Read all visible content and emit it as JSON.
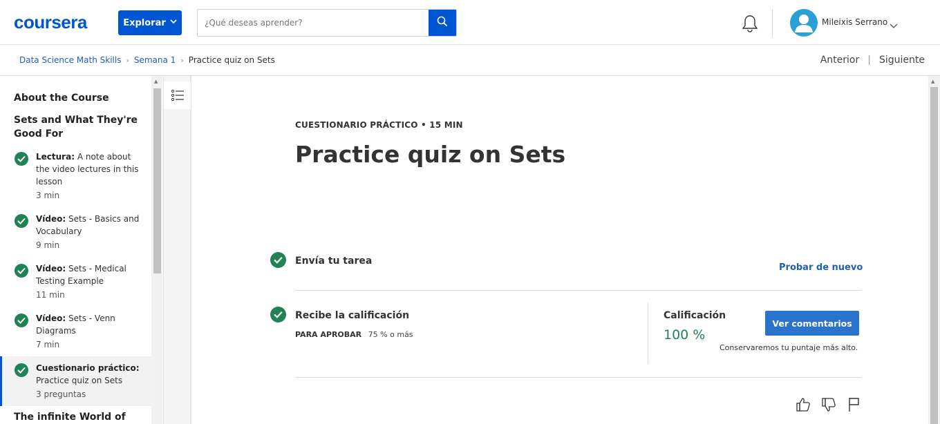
{
  "header": {
    "logo_text": "coursera",
    "explore_label": "Explorar",
    "search_placeholder": "¿Qué deseas aprender?",
    "user_name": "Mileixis Serrano"
  },
  "breadcrumb": {
    "items": [
      "Data Science Math Skills",
      "Semana 1"
    ],
    "current": "Practice quiz on Sets"
  },
  "nav": {
    "prev": "Anterior",
    "next": "Siguiente",
    "separator": "|"
  },
  "sidebar": {
    "sections": [
      {
        "title": "About the Course"
      },
      {
        "title": "Sets and What They're Good For"
      },
      {
        "title": "The infinite World of"
      }
    ],
    "items": [
      {
        "type": "Lectura:",
        "title": "A note about the video lectures in this lesson",
        "duration": "3 min"
      },
      {
        "type": "Vídeo:",
        "title": "Sets - Basics and Vocabulary",
        "duration": "9 min"
      },
      {
        "type": "Vídeo:",
        "title": "Sets - Medical Testing Example",
        "duration": "11 min"
      },
      {
        "type": "Vídeo:",
        "title": "Sets - Venn Diagrams",
        "duration": "7 min"
      },
      {
        "type": "Cuestionario práctico:",
        "title": "Practice quiz on Sets",
        "duration": "3 preguntas"
      }
    ]
  },
  "main": {
    "eyebrow": "CUESTIONARIO PRÁCTICO • 15 MIN",
    "title": "Practice quiz on Sets",
    "step1": {
      "title": "Envía tu tarea",
      "action": "Probar de nuevo"
    },
    "step2": {
      "title": "Recibe la calificación",
      "pass_label": "PARA APROBAR",
      "pass_value": "75 % o más"
    },
    "grade": {
      "label": "Calificación",
      "value": "100 %",
      "button": "Ver comentarios",
      "note": "Conservaremos tu puntaje más alto."
    }
  },
  "colors": {
    "brand": "#0056d2",
    "success": "#1f8354",
    "link": "#1f5fb4"
  },
  "icons": [
    "search-icon",
    "bell-icon",
    "user-avatar-icon",
    "chevron-down-icon",
    "outline-toggle-icon",
    "check-icon",
    "thumbs-up-icon",
    "thumbs-down-icon",
    "flag-icon"
  ]
}
